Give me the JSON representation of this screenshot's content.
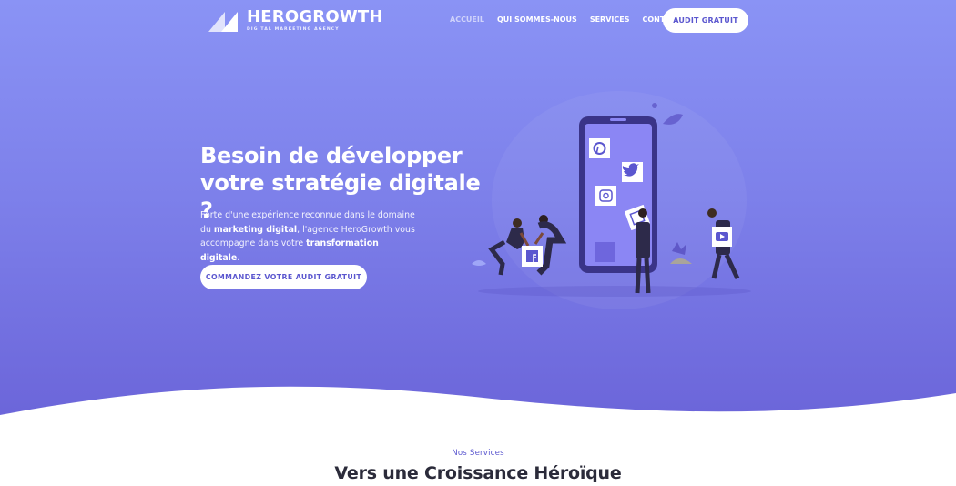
{
  "brand": {
    "name": "HEROGROWTH",
    "tagline": "DIGITAL MARKETING AGENCY"
  },
  "nav": {
    "items": [
      {
        "label": "ACCUEIL",
        "active": true
      },
      {
        "label": "QUI SOMMES-NOUS",
        "active": false
      },
      {
        "label": "SERVICES",
        "active": false
      },
      {
        "label": "CONTACT",
        "active": false
      }
    ],
    "cta_label": "AUDIT GRATUIT"
  },
  "hero": {
    "headline_line1": "Besoin de développer",
    "headline_line2": "votre stratégie digitale ?",
    "para_part1": "Forte d'une expérience reconnue dans le domaine du ",
    "para_bold1": "marketing digital",
    "para_part2": ", l'agence HeroGrowth vous accompagne dans votre ",
    "para_bold2": "transformation digitale",
    "para_part3": ".",
    "cta_label": "COMMANDEZ VOTRE AUDIT GRATUIT"
  },
  "services": {
    "eyebrow": "Nos Services",
    "title": "Vers une Croissance Héroïque"
  },
  "icons": [
    "pinterest-icon",
    "twitter-icon",
    "instagram-icon",
    "facebook-icon",
    "youtube-icon",
    "linkedin-icon"
  ],
  "colors": {
    "hero_top": "#8a93f5",
    "hero_bottom": "#6a63d8",
    "accent": "#5b57cf",
    "phone": "#3a3488",
    "title_text": "#2b2b3a"
  }
}
